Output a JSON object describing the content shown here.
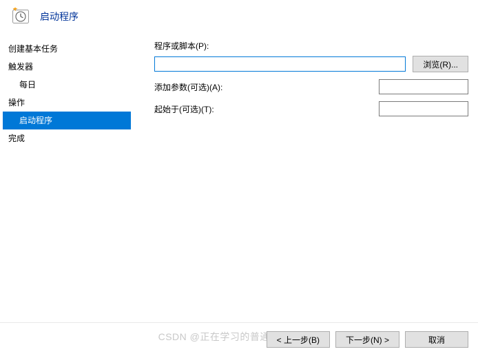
{
  "header": {
    "title": "启动程序"
  },
  "sidebar": {
    "items": [
      {
        "label": "创建基本任务",
        "sub": false
      },
      {
        "label": "触发器",
        "sub": false
      },
      {
        "label": "每日",
        "sub": true
      },
      {
        "label": "操作",
        "sub": false
      },
      {
        "label": "启动程序",
        "sub": true,
        "selected": true
      },
      {
        "label": "完成",
        "sub": false
      }
    ]
  },
  "form": {
    "program_label": "程序或脚本(P):",
    "program_value": "",
    "browse_label": "浏览(R)...",
    "args_label": "添加参数(可选)(A):",
    "args_value": "",
    "startin_label": "起始于(可选)(T):",
    "startin_value": ""
  },
  "footer": {
    "back_label": "< 上一步(B)",
    "next_label": "下一步(N) >",
    "cancel_label": "取消"
  },
  "watermark": "CSDN @正在学习的普通程序员一枚"
}
